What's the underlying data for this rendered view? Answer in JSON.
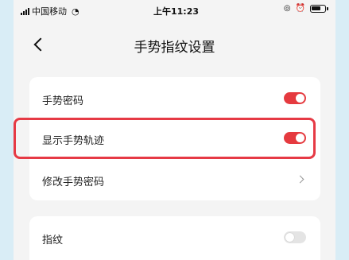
{
  "status_bar": {
    "carrier": "中国移动",
    "time": "上午11:23"
  },
  "nav": {
    "title": "手势指纹设置"
  },
  "settings": {
    "gesture_password": {
      "label": "手势密码",
      "enabled": true
    },
    "show_gesture_trace": {
      "label": "显示手势轨迹",
      "enabled": true
    },
    "change_gesture_password": {
      "label": "修改手势密码"
    },
    "fingerprint": {
      "label": "指纹",
      "enabled": false
    }
  },
  "colors": {
    "accent": "#e53a3f",
    "highlight": "#e63a45",
    "page_bg": "#f4f4f4",
    "outer_bg": "#d9edf6"
  }
}
